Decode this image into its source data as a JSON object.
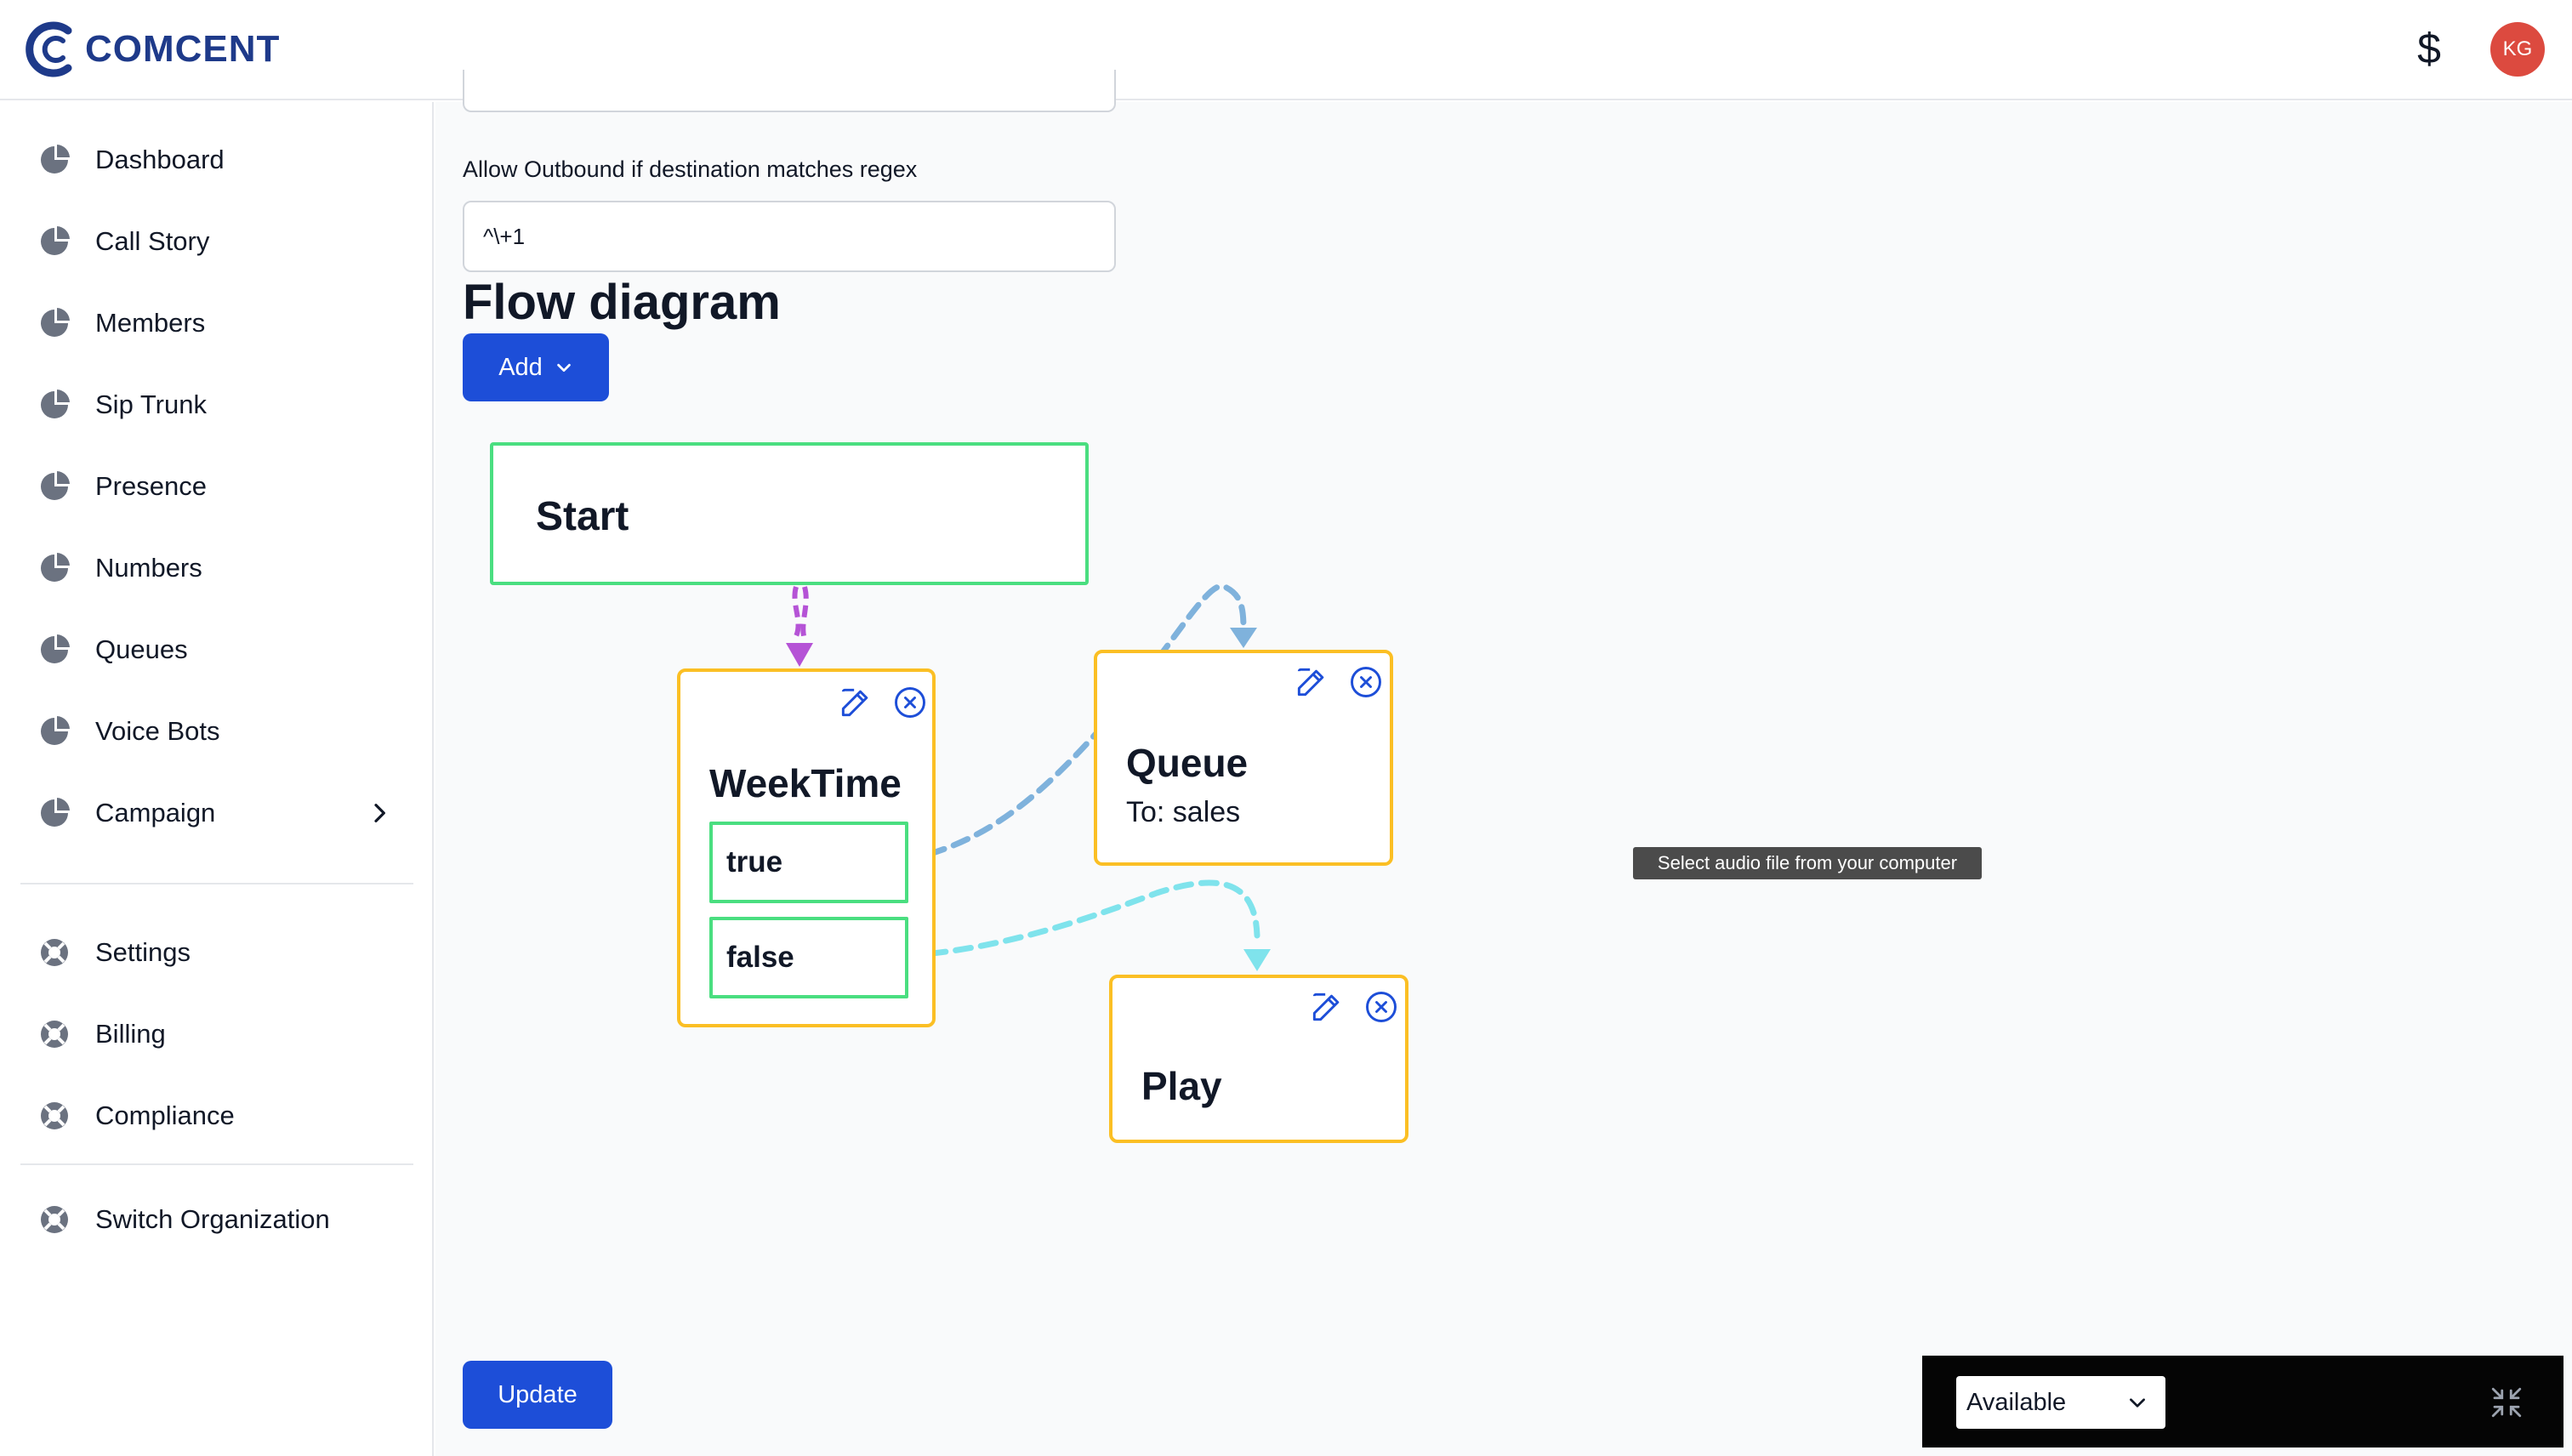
{
  "header": {
    "logo_text": "COMCENT",
    "currency_symbol": "$",
    "avatar_initials": "KG"
  },
  "sidebar": {
    "items": [
      {
        "label": "Dashboard",
        "icon": "pie-chart-icon"
      },
      {
        "label": "Call Story",
        "icon": "pie-chart-icon"
      },
      {
        "label": "Members",
        "icon": "pie-chart-icon"
      },
      {
        "label": "Sip Trunk",
        "icon": "pie-chart-icon"
      },
      {
        "label": "Presence",
        "icon": "pie-chart-icon"
      },
      {
        "label": "Numbers",
        "icon": "pie-chart-icon"
      },
      {
        "label": "Queues",
        "icon": "pie-chart-icon"
      },
      {
        "label": "Voice Bots",
        "icon": "pie-chart-icon"
      },
      {
        "label": "Campaign",
        "icon": "pie-chart-icon",
        "has_submenu": true
      }
    ],
    "secondary_items": [
      {
        "label": "Settings",
        "icon": "lifebuoy-icon"
      },
      {
        "label": "Billing",
        "icon": "lifebuoy-icon"
      },
      {
        "label": "Compliance",
        "icon": "lifebuoy-icon"
      }
    ],
    "footer_items": [
      {
        "label": "Switch Organization",
        "icon": "lifebuoy-icon"
      }
    ]
  },
  "form": {
    "outbound_label": "Allow Outbound if destination matches regex",
    "outbound_value": "^\\+1"
  },
  "flow": {
    "title": "Flow diagram",
    "add_label": "Add",
    "nodes": {
      "start": {
        "title": "Start"
      },
      "weektime": {
        "title": "WeekTime",
        "branches": [
          "true",
          "false"
        ]
      },
      "queue": {
        "title": "Queue",
        "subtitle": "To: sales"
      },
      "play": {
        "title": "Play"
      }
    },
    "edge_colors": {
      "start_to_weektime": "#b553d6",
      "true_to_queue": "#7fb2dc",
      "false_to_play": "#7fe3ec"
    }
  },
  "tooltip": "Select audio file from your computer",
  "update_label": "Update",
  "status": {
    "selected": "Available"
  },
  "colors": {
    "primary": "#1d4ed8",
    "node_border": "#fbbf24",
    "branch_border": "#4ade80",
    "avatar": "#dc4a3f"
  }
}
